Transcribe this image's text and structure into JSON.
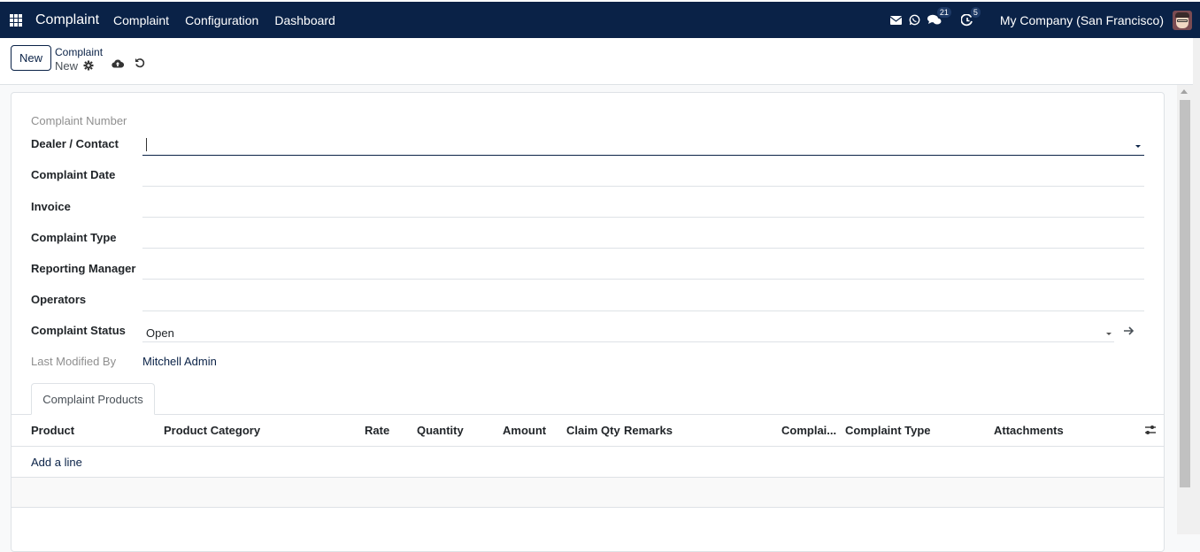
{
  "navbar": {
    "app_name": "Complaint",
    "menu": [
      "Complaint",
      "Configuration",
      "Dashboard"
    ],
    "icons": {
      "apps": "apps-grid-icon",
      "mail": "envelope-icon",
      "whatsapp": "whatsapp-icon",
      "discuss": "chat-bubbles-icon",
      "activity": "clock-activity-icon"
    },
    "discuss_count": "21",
    "activity_count": "5",
    "company": "My Company (San Francisco)"
  },
  "control_panel": {
    "new_button": "New",
    "breadcrumb_parent": "Complaint",
    "breadcrumb_current": "New",
    "icons": {
      "gear": "gear-icon",
      "save": "cloud-upload-icon",
      "discard": "undo-icon"
    }
  },
  "form": {
    "fields": {
      "complaint_number": {
        "label": "Complaint Number",
        "value": ""
      },
      "dealer_contact": {
        "label": "Dealer / Contact",
        "value": ""
      },
      "complaint_date": {
        "label": "Complaint Date",
        "value": ""
      },
      "invoice": {
        "label": "Invoice",
        "value": ""
      },
      "complaint_type": {
        "label": "Complaint Type",
        "value": ""
      },
      "reporting_manager": {
        "label": "Reporting Manager",
        "value": ""
      },
      "operators": {
        "label": "Operators",
        "value": ""
      },
      "complaint_status": {
        "label": "Complaint Status",
        "value": "Open"
      },
      "last_modified_by": {
        "label": "Last Modified By",
        "value": "Mitchell Admin"
      }
    },
    "tabs": [
      {
        "label": "Complaint Products",
        "active": true
      }
    ],
    "products_table": {
      "columns": [
        "Product",
        "Product Category",
        "Rate",
        "Quantity",
        "Amount",
        "Claim Qty",
        "Remarks",
        "Complai...",
        "Complaint Type",
        "Attachments"
      ],
      "rows": [],
      "add_line_label": "Add a line"
    }
  },
  "colors": {
    "navbar_bg": "#0a2247",
    "accent": "#0a2247"
  }
}
